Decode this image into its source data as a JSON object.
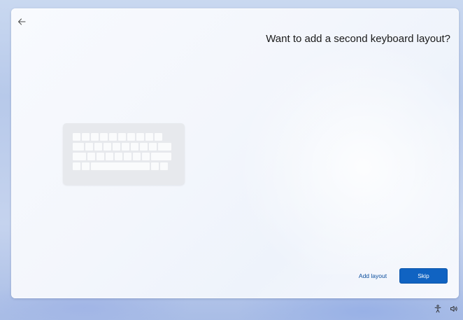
{
  "oobe": {
    "title": "Want to add a second keyboard layout?",
    "add_layout_label": "Add layout",
    "skip_label": "Skip",
    "accent_color": "#1063c2"
  },
  "icons": {
    "back": "back-arrow-icon",
    "illustration": "keyboard-illustration",
    "accessibility": "accessibility-icon",
    "volume": "volume-icon"
  }
}
